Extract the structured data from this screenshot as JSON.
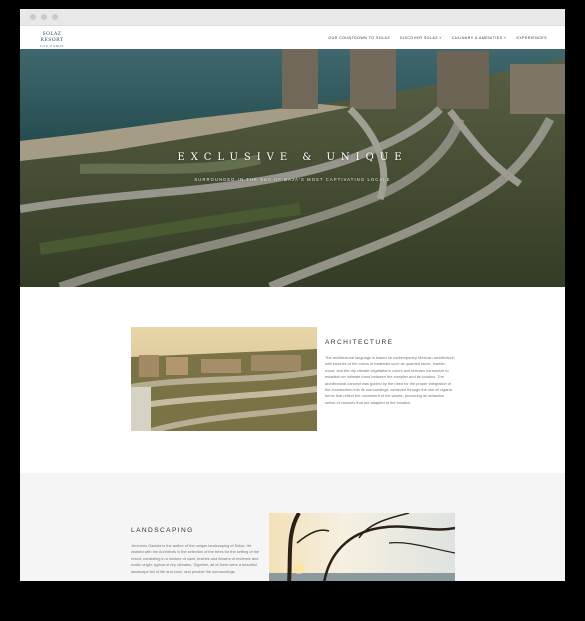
{
  "header": {
    "logo_line1": "SOLAZ RESORT",
    "logo_line2": "LOS CABOS",
    "nav": [
      "OUR COUNTDOWN TO SOLAZ",
      "DISCOVER SOLAZ ˅",
      "CULINARY & AMENITIES ˅",
      "EXPERIENCES"
    ]
  },
  "hero": {
    "title": "EXCLUSIVE & UNIQUE",
    "subtitle": "SURROUNDED IN THE SEA OF BAJA'S MOST CAPTIVATING LOCALE"
  },
  "architecture": {
    "title": "ARCHITECTURE",
    "body": "The architectural language is based on contemporary Mexican architecture, with touches of the colors of materials such as quarried stone, marble, wood, and the dry climate vegetation's colors and textures harmonize to establish an intimate bond between the complex and its location. The architectural concept was guided by the need for the proper integration of the construction into its surroundings, achieved through the use of organic forms that reflect the movement of the waves, producing an attractive series of volumes that are adapted to the location."
  },
  "landscaping": {
    "title": "LANDSCAPING",
    "body": "Jerónimo Gaxiola is the author of the unique landscaping of Solaz. He worked with the Architects in the selection of the trees for the setting of the resort, consisting in a mixture of cacti, bushes and flowers of endemic and exotic origin, typical of dry climates. Together, all of them were a beautiful landscape full of life and color, and provide the surroundings"
  },
  "colors": {
    "brand": "#1d4b5a",
    "background": "#ffffff",
    "section_alt": "#f5f5f5"
  }
}
